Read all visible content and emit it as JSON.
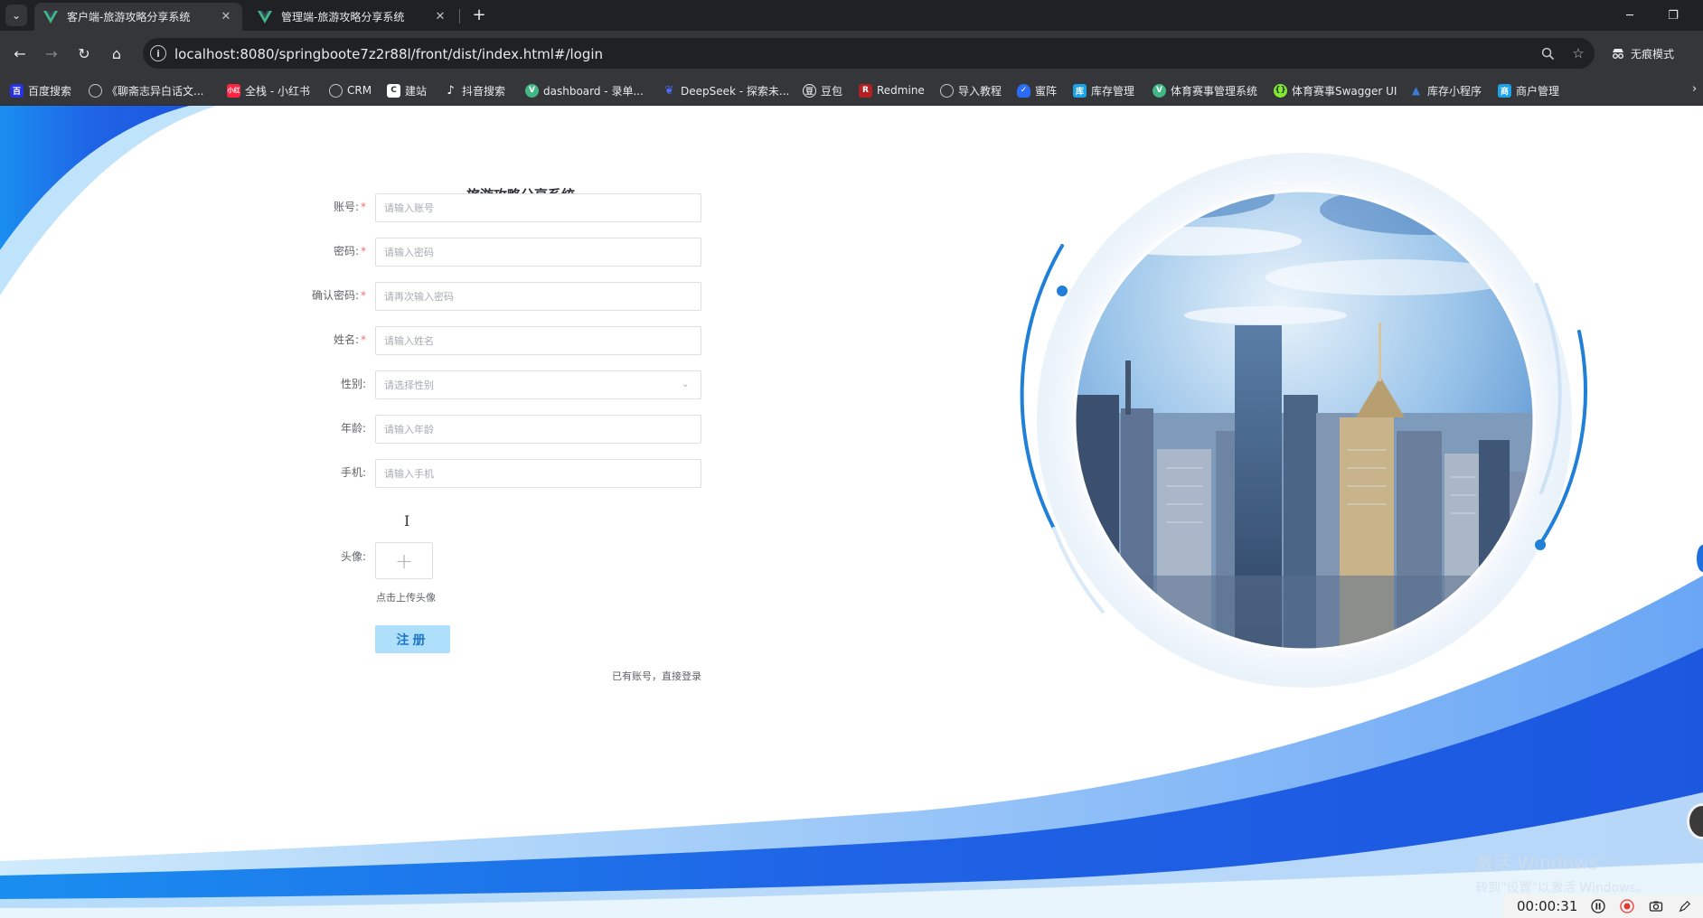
{
  "browser": {
    "tabs": [
      {
        "label": "客户端-旅游攻略分享系统",
        "active": true
      },
      {
        "label": "管理端-旅游攻略分享系统",
        "active": false
      }
    ],
    "url": "localhost:8080/springbootе7z2r88l/front/dist/index.html#/login",
    "incognito_label": "无痕模式",
    "bookmarks": [
      {
        "label": "百度搜索",
        "icon": "baidu-icon",
        "color": "#2932e1"
      },
      {
        "label": "《聊斋志异白话文...",
        "icon": "globe-icon",
        "color": "#5f6368"
      },
      {
        "label": "全栈 - 小红书",
        "icon": "xiaohongshu-icon",
        "color": "#ff2442"
      },
      {
        "label": "CRM",
        "icon": "globe-icon",
        "color": "#5f6368"
      },
      {
        "label": "建站",
        "icon": "site-icon",
        "color": "#ffffff"
      },
      {
        "label": "抖音搜索",
        "icon": "douyin-icon",
        "color": "#111111"
      },
      {
        "label": "dashboard - 录单...",
        "icon": "vue-icon",
        "color": "#41b883"
      },
      {
        "label": "DeepSeek - 探索未...",
        "icon": "deepseek-icon",
        "color": "#4d6bfe"
      },
      {
        "label": "豆包",
        "icon": "doubao-icon",
        "color": "#ffffff"
      },
      {
        "label": "Redmine",
        "icon": "redmine-icon",
        "color": "#b32024"
      },
      {
        "label": "导入教程",
        "icon": "globe-icon",
        "color": "#5f6368"
      },
      {
        "label": "蜜阵",
        "icon": "shield-icon",
        "color": "#2b6cf6"
      },
      {
        "label": "库存管理",
        "icon": "app-icon",
        "color": "#1aa3e8"
      },
      {
        "label": "体育赛事管理系统",
        "icon": "vue-icon",
        "color": "#41b883"
      },
      {
        "label": "体育赛事Swagger UI",
        "icon": "swagger-icon",
        "color": "#85ea2d"
      },
      {
        "label": "库存小程序",
        "icon": "triangle-icon",
        "color": "#3a7bd5"
      },
      {
        "label": "商户管理",
        "icon": "app-icon",
        "color": "#1aa3e8"
      }
    ]
  },
  "form": {
    "title": "旅游攻略分享系统",
    "fields": [
      {
        "label": "账号:",
        "required": true,
        "placeholder": "请输入账号"
      },
      {
        "label": "密码:",
        "required": true,
        "placeholder": "请输入密码"
      },
      {
        "label": "确认密码:",
        "required": true,
        "placeholder": "请再次输入密码"
      },
      {
        "label": "姓名:",
        "required": true,
        "placeholder": "请输入姓名"
      },
      {
        "label": "性别:",
        "required": false,
        "placeholder": "请选择性别",
        "type": "select"
      },
      {
        "label": "年龄:",
        "required": false,
        "placeholder": "请输入年龄"
      },
      {
        "label": "手机:",
        "required": false,
        "placeholder": "请输入手机"
      }
    ],
    "avatar_label": "头像:",
    "upload_tip": "点击上传头像",
    "register_label": "注册",
    "login_link": "已有账号，直接登录"
  },
  "overlay": {
    "watermark_title": "激活 Windows",
    "watermark_sub": "转到\"设置\"以激活 Windows。",
    "recording_time": "00:00:31"
  },
  "colors": {
    "brand_blue": "#1e74c4",
    "button_bg": "#aee0fb",
    "required": "#f56c6c"
  }
}
